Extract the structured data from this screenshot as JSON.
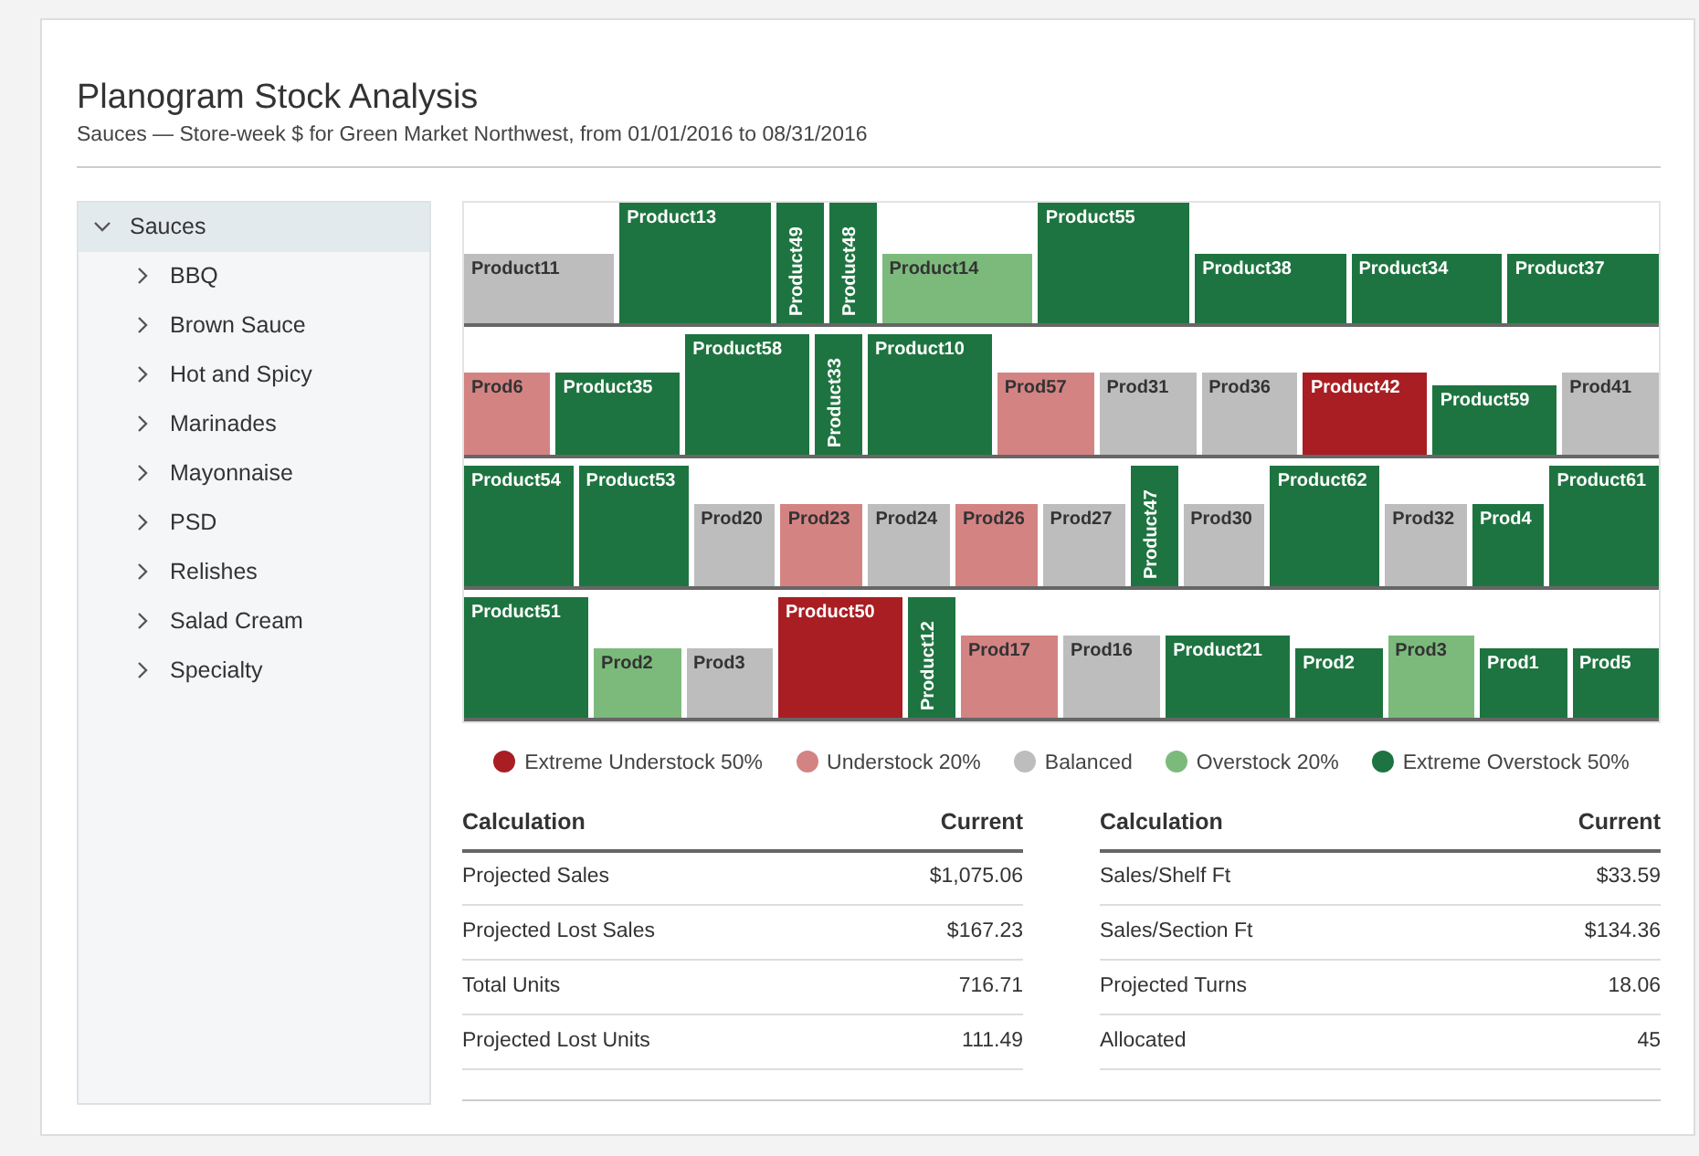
{
  "title": "Planogram Stock Analysis",
  "subtitle": "Sauces — Store-week $ for Green Market Northwest, from 01/01/2016 to 08/31/2016",
  "tree": [
    {
      "label": "Sauces",
      "expanded": true,
      "selected": true,
      "children": [
        {
          "label": "BBQ",
          "expanded": false
        },
        {
          "label": "Brown Sauce",
          "expanded": false
        },
        {
          "label": "Hot and Spicy",
          "expanded": false
        },
        {
          "label": "Marinades",
          "expanded": false
        },
        {
          "label": "Mayonnaise",
          "expanded": false
        },
        {
          "label": "PSD",
          "expanded": false
        },
        {
          "label": "Relishes",
          "expanded": false
        },
        {
          "label": "Salad Cream",
          "expanded": false
        },
        {
          "label": "Specialty",
          "expanded": false
        }
      ]
    }
  ],
  "shelves": [
    {
      "products": [
        {
          "label": "Product11",
          "color": "#bdbdbd",
          "kind": "short"
        },
        {
          "label": "Product13",
          "color": "#1e7440",
          "kind": "full"
        },
        {
          "label": "Product49",
          "color": "#1e7440",
          "kind": "vertical"
        },
        {
          "label": "Product48",
          "color": "#1e7440",
          "kind": "vertical"
        },
        {
          "label": "Product14",
          "color": "#7cba7c",
          "kind": "short"
        },
        {
          "label": "Product55",
          "color": "#1e7440",
          "kind": "full"
        },
        {
          "label": "Product38",
          "color": "#1e7440",
          "kind": "short"
        },
        {
          "label": "Product34",
          "color": "#1e7440",
          "kind": "short"
        },
        {
          "label": "Product37",
          "color": "#1e7440",
          "kind": "short"
        }
      ]
    },
    {
      "products": [
        {
          "label": "Prod6",
          "color": "#d48383",
          "kind": "medium"
        },
        {
          "label": "Product35",
          "color": "#1e7440",
          "kind": "medium"
        },
        {
          "label": "Product58",
          "color": "#1e7440",
          "kind": "full"
        },
        {
          "label": "Product33",
          "color": "#1e7440",
          "kind": "vertical"
        },
        {
          "label": "Product10",
          "color": "#1e7440",
          "kind": "full"
        },
        {
          "label": "Prod57",
          "color": "#d48383",
          "kind": "medium"
        },
        {
          "label": "Prod31",
          "color": "#bdbdbd",
          "kind": "medium"
        },
        {
          "label": "Prod36",
          "color": "#bdbdbd",
          "kind": "medium"
        },
        {
          "label": "Product42",
          "color": "#a81e22",
          "kind": "medium"
        },
        {
          "label": "Product59",
          "color": "#1e7440",
          "kind": "short"
        },
        {
          "label": "Prod41",
          "color": "#bdbdbd",
          "kind": "medium"
        }
      ]
    },
    {
      "products": [
        {
          "label": "Product54",
          "color": "#1e7440",
          "kind": "full"
        },
        {
          "label": "Product53",
          "color": "#1e7440",
          "kind": "full"
        },
        {
          "label": "Prod20",
          "color": "#bdbdbd",
          "kind": "medium"
        },
        {
          "label": "Prod23",
          "color": "#d48383",
          "kind": "medium"
        },
        {
          "label": "Prod24",
          "color": "#bdbdbd",
          "kind": "medium"
        },
        {
          "label": "Prod26",
          "color": "#d48383",
          "kind": "medium"
        },
        {
          "label": "Prod27",
          "color": "#bdbdbd",
          "kind": "medium"
        },
        {
          "label": "Product47",
          "color": "#1e7440",
          "kind": "vertical"
        },
        {
          "label": "Prod30",
          "color": "#bdbdbd",
          "kind": "medium"
        },
        {
          "label": "Product62",
          "color": "#1e7440",
          "kind": "full"
        },
        {
          "label": "Prod32",
          "color": "#bdbdbd",
          "kind": "medium"
        },
        {
          "label": "Prod4",
          "color": "#1e7440",
          "kind": "medium"
        },
        {
          "label": "Product61",
          "color": "#1e7440",
          "kind": "full"
        }
      ]
    },
    {
      "products": [
        {
          "label": "Product51",
          "color": "#1e7440",
          "kind": "full"
        },
        {
          "label": "Prod2",
          "color": "#7cba7c",
          "kind": "short"
        },
        {
          "label": "Prod3",
          "color": "#bdbdbd",
          "kind": "short"
        },
        {
          "label": "Product50",
          "color": "#a81e22",
          "kind": "full"
        },
        {
          "label": "Product12",
          "color": "#1e7440",
          "kind": "vertical"
        },
        {
          "label": "Prod17",
          "color": "#d48383",
          "kind": "medium"
        },
        {
          "label": "Prod16",
          "color": "#bdbdbd",
          "kind": "medium"
        },
        {
          "label": "Product21",
          "color": "#1e7440",
          "kind": "medium"
        },
        {
          "label": "Prod2",
          "color": "#1e7440",
          "kind": "short"
        },
        {
          "label": "Prod3",
          "color": "#7cba7c",
          "kind": "medium"
        },
        {
          "label": "Prod1",
          "color": "#1e7440",
          "kind": "short"
        },
        {
          "label": "Prod5",
          "color": "#1e7440",
          "kind": "short"
        }
      ]
    }
  ],
  "legend": [
    {
      "label": "Extreme Understock 50%",
      "color": "#a81e22"
    },
    {
      "label": "Understock 20%",
      "color": "#d48383"
    },
    {
      "label": "Balanced",
      "color": "#bdbdbd"
    },
    {
      "label": "Overstock 20%",
      "color": "#7cba7c"
    },
    {
      "label": "Extreme Overstock 50%",
      "color": "#1e7440"
    }
  ],
  "tables": [
    {
      "columns": [
        "Calculation",
        "Current"
      ],
      "rows": [
        [
          "Projected Sales",
          "$1,075.06"
        ],
        [
          "Projected Lost Sales",
          "$167.23"
        ],
        [
          "Total Units",
          "716.71"
        ],
        [
          "Projected Lost Units",
          "111.49"
        ]
      ]
    },
    {
      "columns": [
        "Calculation",
        "Current"
      ],
      "rows": [
        [
          "Sales/Shelf Ft",
          "$33.59"
        ],
        [
          "Sales/Section Ft",
          "$134.36"
        ],
        [
          "Projected Turns",
          "18.06"
        ],
        [
          "Allocated",
          "45"
        ]
      ]
    }
  ]
}
